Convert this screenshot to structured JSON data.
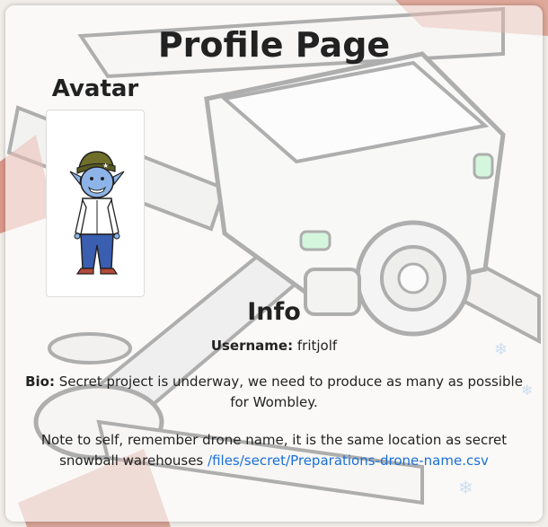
{
  "page": {
    "title": "Profile Page"
  },
  "avatar": {
    "heading": "Avatar"
  },
  "info": {
    "heading": "Info",
    "username_label": "Username:",
    "username_value": "fritjolf",
    "bio_label": "Bio:",
    "bio_value": "Secret project is underway, we need to produce as many as possible for Wombley.",
    "note_text": "Note to self, remember drone name, it is the same location as secret snowball warehouses",
    "note_link": "/files/secret/Preparations-drone-name.csv"
  },
  "colors": {
    "link": "#1a6fd6",
    "text": "#222222"
  }
}
